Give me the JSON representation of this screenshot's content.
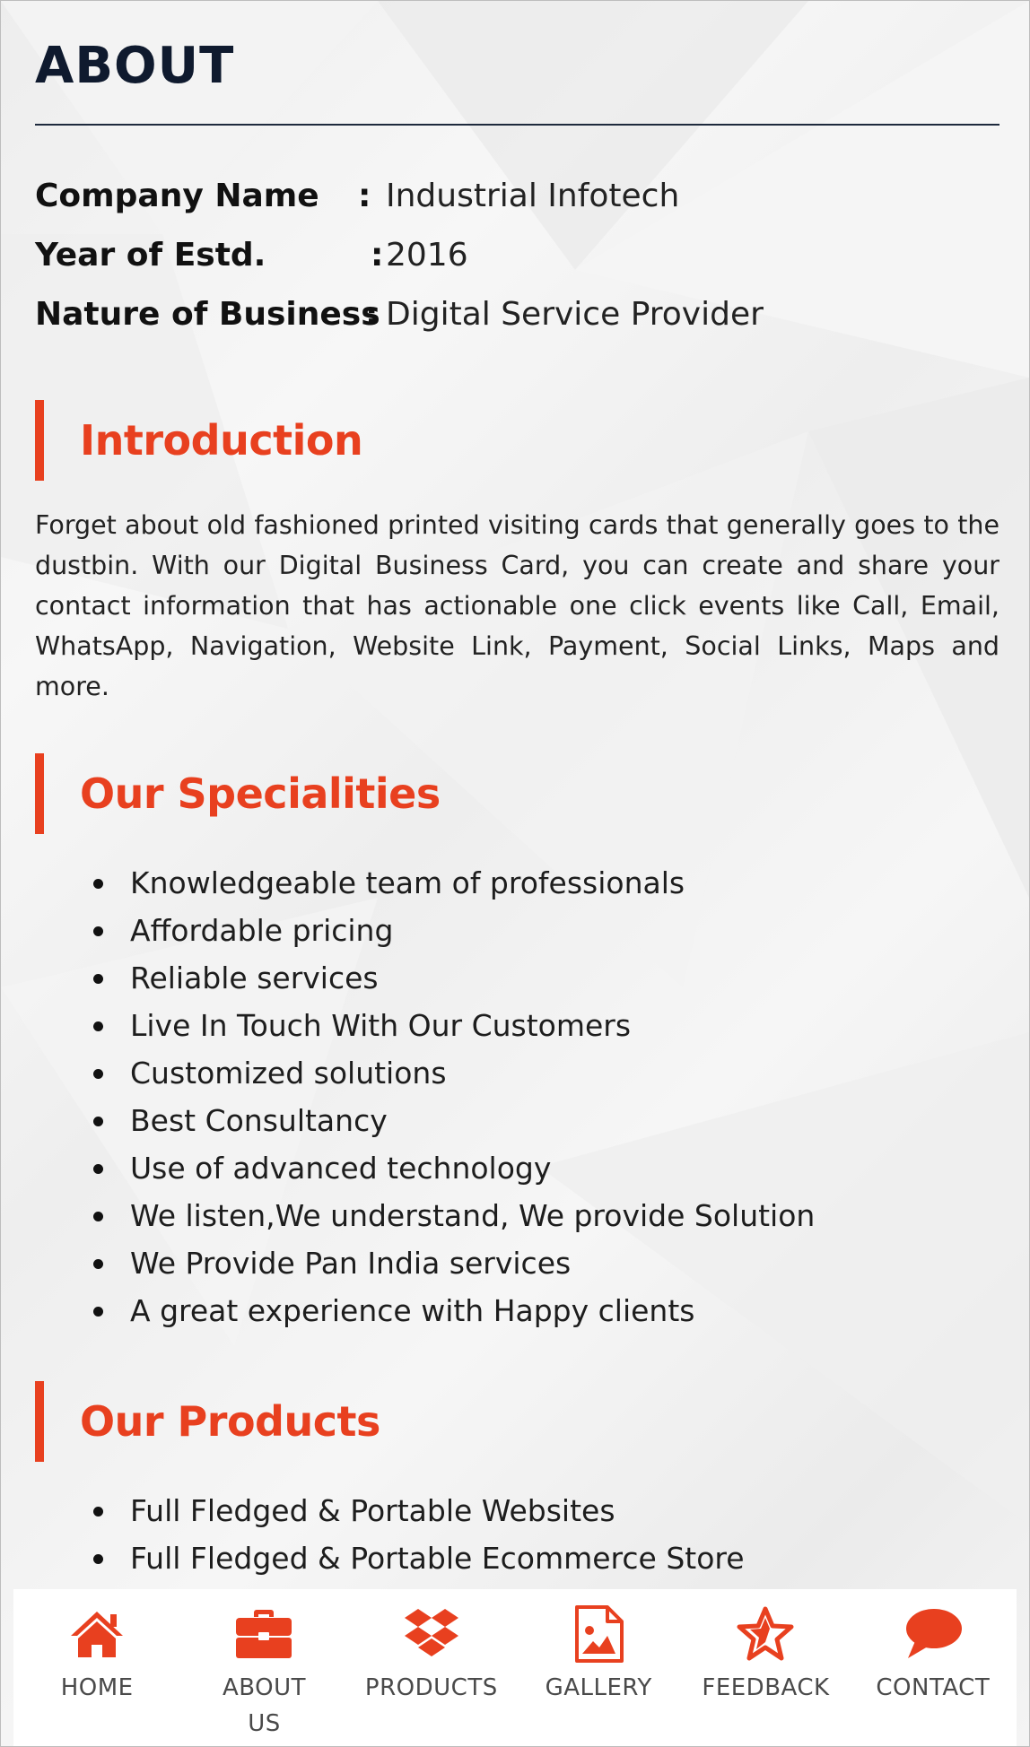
{
  "colors": {
    "accent": "#e8401f",
    "heading": "#0f1a2e",
    "text": "#222222",
    "nav_label": "#4a4a4a"
  },
  "page_title": "ABOUT",
  "company_info": [
    {
      "label": "Company Name",
      "colon": ":",
      "value": "Industrial Infotech"
    },
    {
      "label": "Year of Estd.",
      "colon": ":",
      "value": "2016"
    },
    {
      "label": "Nature of Business",
      "colon": ":",
      "value": "Digital Service Provider"
    }
  ],
  "introduction": {
    "heading": "Introduction",
    "text": "Forget about old fashioned printed visiting cards that generally goes to the dustbin. With our Digital Business Card, you can create and share your contact information that has actionable one click events like Call, Email, WhatsApp, Navigation, Website Link, Payment, Social Links, Maps and more."
  },
  "specialities": {
    "heading": "Our Specialities",
    "items": [
      "Knowledgeable team of professionals",
      "Affordable pricing",
      "Reliable services",
      "Live In Touch With Our Customers",
      "Customized solutions",
      "Best Consultancy",
      "Use of advanced technology",
      "We listen,We understand, We provide Solution",
      "We Provide Pan India services",
      "A great experience with Happy clients"
    ]
  },
  "products": {
    "heading": "Our Products",
    "items": [
      "Full Fledged & Portable Websites",
      "Full Fledged & Portable Ecommerce Store"
    ]
  },
  "bottom_nav": [
    {
      "label": "HOME",
      "icon": "home-icon"
    },
    {
      "label": "ABOUT\nUS",
      "icon": "briefcase-icon"
    },
    {
      "label": "PRODUCTS",
      "icon": "dropbox-icon"
    },
    {
      "label": "GALLERY",
      "icon": "image-file-icon"
    },
    {
      "label": "FEEDBACK",
      "icon": "star-icon"
    },
    {
      "label": "CONTACT",
      "icon": "chat-bubble-icon"
    }
  ]
}
